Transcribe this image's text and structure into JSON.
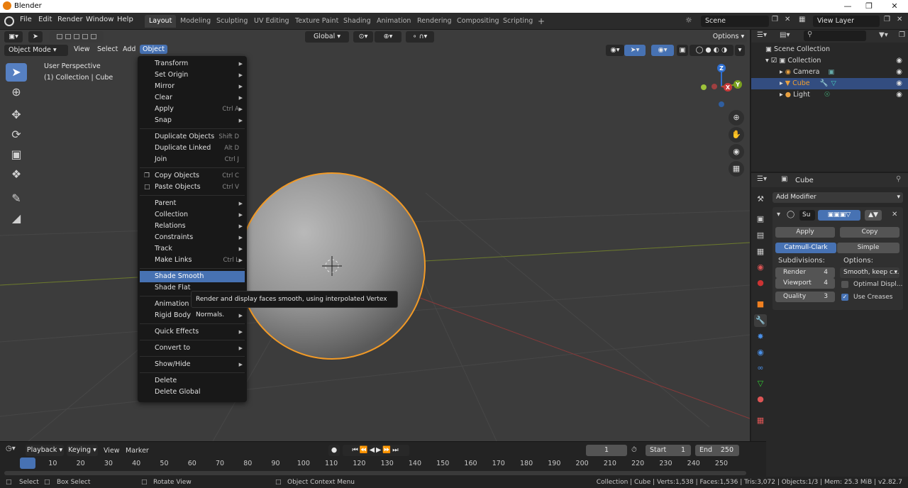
{
  "window": {
    "title": "Blender"
  },
  "menubar": {
    "items": [
      "File",
      "Edit",
      "Render",
      "Window",
      "Help"
    ]
  },
  "workspaces": {
    "tabs": [
      "Layout",
      "Modeling",
      "Sculpting",
      "UV Editing",
      "Texture Paint",
      "Shading",
      "Animation",
      "Rendering",
      "Compositing",
      "Scripting"
    ],
    "active": "Layout",
    "add": "+"
  },
  "scene": {
    "value": "Scene"
  },
  "view_layer": {
    "value": "View Layer"
  },
  "tool_header": {
    "orientation": "Global",
    "options": "Options"
  },
  "viewport_header": {
    "mode": "Object Mode",
    "menus": [
      "View",
      "Select",
      "Add",
      "Object"
    ],
    "active_menu": "Object"
  },
  "viewport": {
    "perspective": "User Perspective",
    "collection_info": "(1) Collection | Cube"
  },
  "gizmo": {
    "z": "Z",
    "y": "Y",
    "x": "X"
  },
  "object_menu": {
    "items": [
      {
        "label": "Transform",
        "submenu": true
      },
      {
        "label": "Set Origin",
        "submenu": true
      },
      {
        "label": "Mirror",
        "submenu": true
      },
      {
        "label": "Clear",
        "submenu": true
      },
      {
        "label": "Apply",
        "shortcut": "Ctrl A",
        "submenu": true
      },
      {
        "label": "Snap",
        "submenu": true
      },
      {
        "label": "Duplicate Objects",
        "shortcut": "Shift D"
      },
      {
        "label": "Duplicate Linked",
        "shortcut": "Alt D"
      },
      {
        "label": "Join",
        "shortcut": "Ctrl J"
      },
      {
        "label": "Copy Objects",
        "shortcut": "Ctrl C"
      },
      {
        "label": "Paste Objects",
        "shortcut": "Ctrl V"
      },
      {
        "label": "Parent",
        "submenu": true
      },
      {
        "label": "Collection",
        "submenu": true
      },
      {
        "label": "Relations",
        "submenu": true
      },
      {
        "label": "Constraints",
        "submenu": true
      },
      {
        "label": "Track",
        "submenu": true
      },
      {
        "label": "Make Links",
        "shortcut": "Ctrl L",
        "submenu": true
      },
      {
        "label": "Shade Smooth",
        "highlighted": true
      },
      {
        "label": "Shade Flat"
      },
      {
        "label": "Animation",
        "submenu": true
      },
      {
        "label": "Rigid Body",
        "submenu": true
      },
      {
        "label": "Quick Effects",
        "submenu": true
      },
      {
        "label": "Convert to",
        "submenu": true
      },
      {
        "label": "Show/Hide",
        "submenu": true
      },
      {
        "label": "Delete"
      },
      {
        "label": "Delete Global"
      }
    ],
    "tooltip": "Render and display faces smooth, using interpolated Vertex Normals."
  },
  "outliner": {
    "root": "Scene Collection",
    "rows": [
      {
        "label": "Collection"
      },
      {
        "label": "Camera"
      },
      {
        "label": "Cube",
        "selected": true
      },
      {
        "label": "Light"
      }
    ]
  },
  "properties": {
    "object_name": "Cube",
    "add_modifier": "Add Modifier",
    "modifier_name": "Su",
    "apply": "Apply",
    "copy": "Copy",
    "type_catmull": "Catmull-Clark",
    "type_simple": "Simple",
    "subdivisions_label": "Subdivisions:",
    "options_label": "Options:",
    "render_label": "Render",
    "render_value": "4",
    "viewport_label": "Viewport",
    "viewport_value": "4",
    "quality_label": "Quality",
    "quality_value": "3",
    "uv_smooth": "Smooth, keep c...",
    "optimal_display": "Optimal Displ...",
    "use_creases": "Use Creases"
  },
  "timeline": {
    "menus": [
      "Playback",
      "Keying",
      "View",
      "Marker"
    ],
    "current_frame": "1",
    "start_label": "Start",
    "start_value": "1",
    "end_label": "End",
    "end_value": "250",
    "ticks": [
      "1",
      "10",
      "20",
      "30",
      "40",
      "50",
      "60",
      "70",
      "80",
      "90",
      "100",
      "110",
      "120",
      "130",
      "140",
      "150",
      "160",
      "170",
      "180",
      "190",
      "200",
      "210",
      "220",
      "230",
      "240",
      "250"
    ]
  },
  "statusbar": {
    "select": "Select",
    "box_select": "Box Select",
    "rotate_view": "Rotate View",
    "context_menu": "Object Context Menu",
    "stats": "Collection | Cube | Verts:1,538 | Faces:1,536 | Tris:3,072 | Objects:1/3 | Mem: 25.3 MiB | v2.82.7"
  },
  "colors": {
    "accent": "#4772b3",
    "selection_outline": "#f29a26",
    "background": "#3c3c3c"
  }
}
